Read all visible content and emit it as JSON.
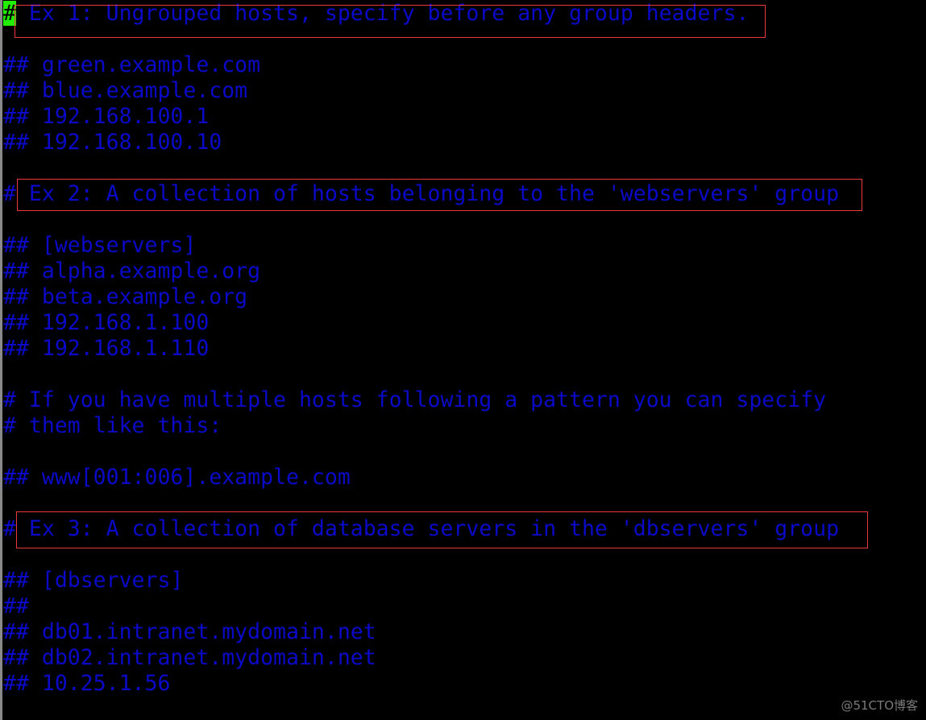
{
  "editor": {
    "text_color": "#0a0ac8",
    "cursor_color": "#22ee00",
    "cursor_char": "#",
    "lines": [
      " Ex 1: Ungrouped hosts, specify before any group headers.",
      "",
      "## green.example.com",
      "## blue.example.com",
      "## 192.168.100.1",
      "## 192.168.100.10",
      "",
      "# Ex 2: A collection of hosts belonging to the 'webservers' group",
      "",
      "## [webservers]",
      "## alpha.example.org",
      "## beta.example.org",
      "## 192.168.1.100",
      "## 192.168.1.110",
      "",
      "# If you have multiple hosts following a pattern you can specify",
      "# them like this:",
      "",
      "## www[001:006].example.com",
      "",
      "# Ex 3: A collection of database servers in the 'dbservers' group",
      "",
      "## [dbservers]",
      "##",
      "## db01.intranet.mydomain.net",
      "## db02.intranet.mydomain.net",
      "## 10.25.1.56"
    ]
  },
  "highlight_color": "#e83a3a",
  "watermark": "@51CTO博客"
}
